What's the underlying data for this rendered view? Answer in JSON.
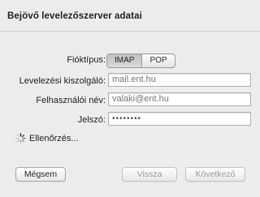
{
  "dialog": {
    "title": "Bejövő levelezőszerver adatai"
  },
  "form": {
    "account_type": {
      "label": "Fióktípus:",
      "options": [
        "IMAP",
        "POP"
      ],
      "selected": "IMAP"
    },
    "server": {
      "label": "Levelezési kiszolgáló:",
      "value": "mail.ent.hu"
    },
    "username": {
      "label": "Felhasználói név:",
      "value": "valaki@ent.hu"
    },
    "password": {
      "label": "Jelszó:",
      "value": "••••••••"
    }
  },
  "status": {
    "icon": "spinner-icon",
    "text": "Ellenőrzés..."
  },
  "buttons": {
    "cancel": "Mégsem",
    "back": "Vissza",
    "next": "Következő"
  }
}
